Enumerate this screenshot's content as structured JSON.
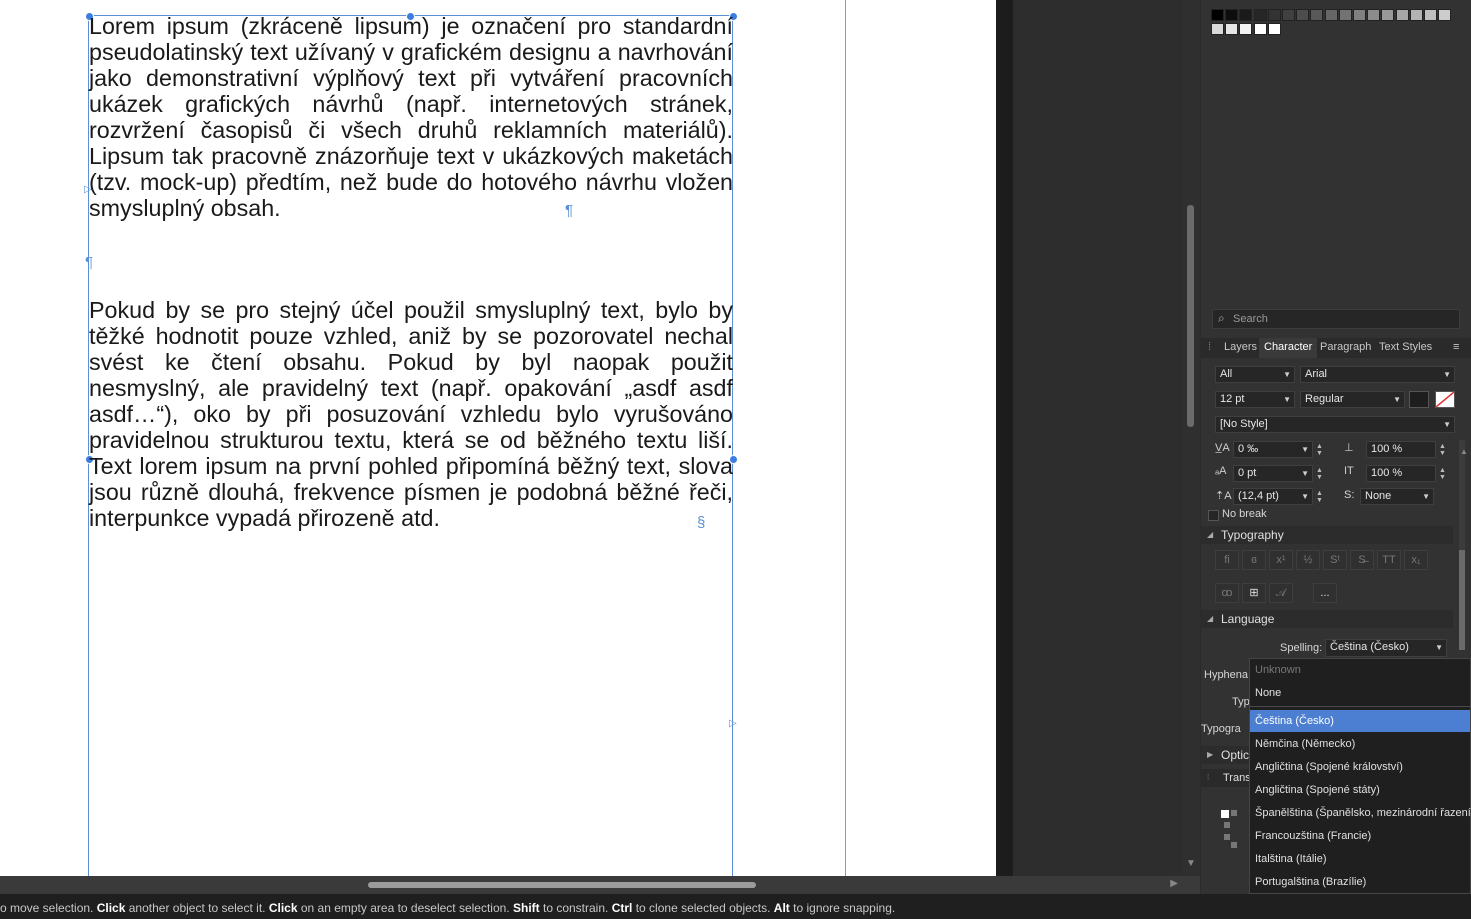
{
  "document": {
    "paragraph1": "Lorem ipsum (zkráceně lipsum) je označení pro standardní pseudolatinský text užívaný v grafickém designu a navrhování jako demonstrativní výplňový text při vytváření pracovních ukázek grafických návrhů (např. internetových stránek, rozvržení časopisů či všech druhů reklamních materiálů). Lipsum tak pracovně znázorňuje text v ukázkových maketách (tzv. mock-up) předtím, než bude do hotového návrhu vložen smysluplný obsah.",
    "paragraph2": "Pokud by se pro stejný účel použil smysluplný text, bylo by těžké hodnotit pouze vzhled, aniž by se pozorovatel nechal svést ke čtení obsahu. Pokud by byl naopak použit nesmyslný, ale pravidelný text (např. opakování „asdf asdf asdf…“), oko by při posuzování vzhledu bylo vyrušováno pravidelnou strukturou textu, která se od běžného textu liší. Text lorem ipsum na první pohled připomíná běžný text, slova jsou různě dlouhá, frekvence písmen je podobná běžné řeči, interpunkce vypadá přirozeně atd.",
    "pilcrow": "¶",
    "section_mark": "§"
  },
  "statusbar": [
    {
      "t": "o move selection. ",
      "b": false
    },
    {
      "t": "Click",
      "b": true
    },
    {
      "t": " another object to select it. ",
      "b": false
    },
    {
      "t": "Click",
      "b": true
    },
    {
      "t": " on an empty area to deselect selection. ",
      "b": false
    },
    {
      "t": "Shift",
      "b": true
    },
    {
      "t": " to constrain. ",
      "b": false
    },
    {
      "t": "Ctrl",
      "b": true
    },
    {
      "t": " to clone selected objects. ",
      "b": false
    },
    {
      "t": "Alt",
      "b": true
    },
    {
      "t": " to ignore snapping.",
      "b": false
    }
  ],
  "panel": {
    "swatch_colors": [
      "#000000",
      "#0d0d0d",
      "#1a1a1a",
      "#262626",
      "#333333",
      "#404040",
      "#4d4d4d",
      "#595959",
      "#666666",
      "#737373",
      "#808080",
      "#8c8c8c",
      "#999999",
      "#a6a6a6",
      "#b3b3b3",
      "#bfbfbf",
      "#cccccc",
      "#d9d9d9",
      "#e6e6e6",
      "#f2f2f2",
      "#ffffff",
      "#ffffff"
    ],
    "search_placeholder": "Search",
    "tabs": [
      "Layers",
      "Character",
      "Paragraph",
      "Text Styles"
    ],
    "active_tab": "Character",
    "character": {
      "scope": "All",
      "font_family": "Arial",
      "font_size": "12 pt",
      "font_weight": "Regular",
      "style": "[No Style]",
      "tracking": "0 ‰",
      "vertical_scale": "100 %",
      "baseline": "0 pt",
      "horizontal_scale": "100 %",
      "leading": "(12,4 pt)",
      "s_label": "S:",
      "s_value": "None",
      "no_break": "No break",
      "fill_color": "#1e1e1e"
    },
    "typography_title": "Typography",
    "more_button": "...",
    "language_title": "Language",
    "spelling_label": "Spelling:",
    "spelling_value": "Čeština (Česko)",
    "partial_labels": [
      "Hyphena",
      "Typ",
      "Typogra",
      "Optic",
      "Trans"
    ]
  },
  "language_menu": {
    "options": [
      {
        "label": "Unknown",
        "state": "disabled"
      },
      {
        "label": "None",
        "state": "normal"
      },
      {
        "label": "Čeština (Česko)",
        "state": "selected"
      },
      {
        "label": "Němčina (Německo)",
        "state": "normal"
      },
      {
        "label": "Angličtina (Spojené království)",
        "state": "normal"
      },
      {
        "label": "Angličtina (Spojené státy)",
        "state": "normal"
      },
      {
        "label": "Španělština (Španělsko, mezinárodní řazení)",
        "state": "normal"
      },
      {
        "label": "Francouzština (Francie)",
        "state": "normal"
      },
      {
        "label": "Italština (Itálie)",
        "state": "normal"
      },
      {
        "label": "Portugalština (Brazílie)",
        "state": "normal"
      }
    ]
  },
  "colors": {
    "selection_blue": "#4c7fd1",
    "frame_blue": "#5b8fd6"
  }
}
